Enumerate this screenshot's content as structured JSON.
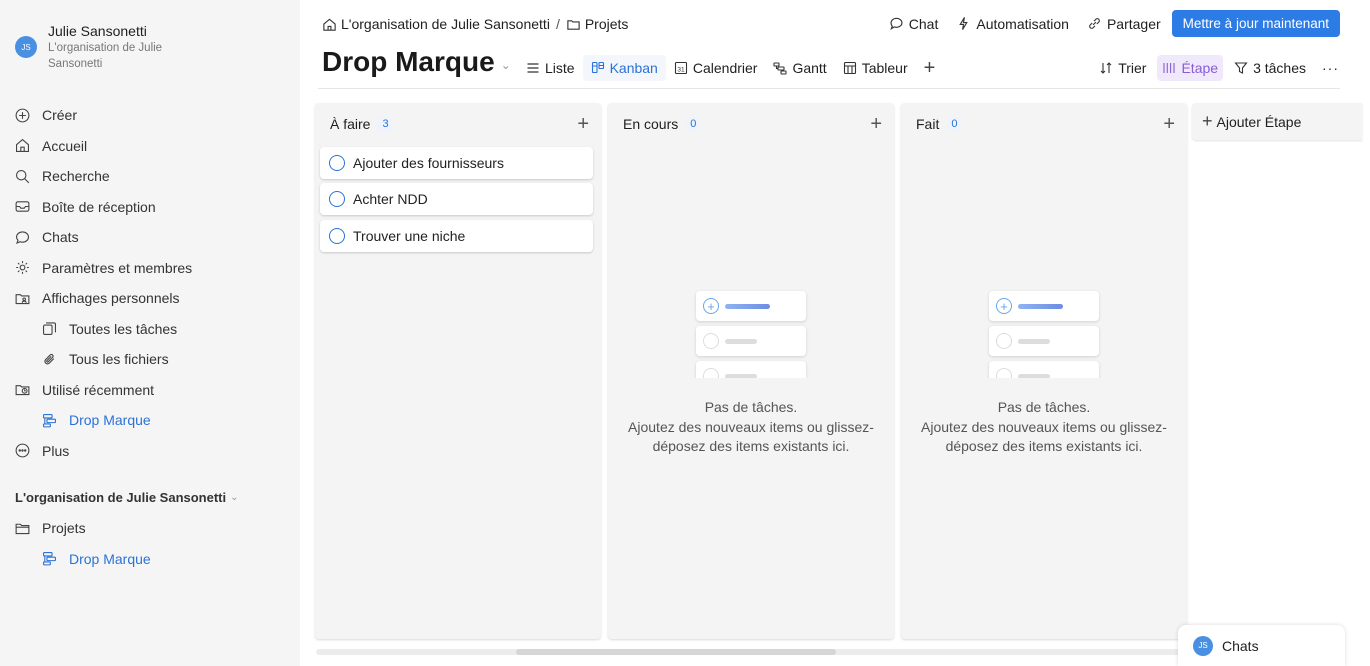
{
  "user": {
    "name": "Julie Sansonetti",
    "org": "L'organisation de Julie Sansonetti",
    "initials": "JS"
  },
  "sidebar": {
    "items": [
      {
        "label": "Créer",
        "icon": "plus-circle-icon"
      },
      {
        "label": "Accueil",
        "icon": "home-icon"
      },
      {
        "label": "Recherche",
        "icon": "search-icon"
      },
      {
        "label": "Boîte de réception",
        "icon": "inbox-icon"
      },
      {
        "label": "Chats",
        "icon": "chat-icon"
      },
      {
        "label": "Paramètres et membres",
        "icon": "gear-icon"
      },
      {
        "label": "Affichages personnels",
        "icon": "folder-person-icon"
      },
      {
        "label": "Toutes les tâches",
        "icon": "tasks-stack-icon"
      },
      {
        "label": "Tous les fichiers",
        "icon": "paperclip-icon"
      },
      {
        "label": "Utilisé récemment",
        "icon": "folder-clock-icon"
      },
      {
        "label": "Drop Marque",
        "icon": "project-icon"
      },
      {
        "label": "Plus",
        "icon": "more-circle-icon"
      }
    ],
    "org_title": "L'organisation de Julie Sansonetti",
    "org_items": [
      {
        "label": "Projets",
        "icon": "folder-icon"
      },
      {
        "label": "Drop Marque",
        "icon": "project-icon"
      }
    ]
  },
  "breadcrumb": {
    "org": "L'organisation de Julie Sansonetti",
    "sep": "/",
    "folder": "Projets"
  },
  "top_actions": {
    "chat": "Chat",
    "automation": "Automatisation",
    "share": "Partager",
    "upgrade": "Mettre à jour maintenant"
  },
  "page_title": "Drop Marque",
  "views": [
    {
      "label": "Liste",
      "icon": "list-icon"
    },
    {
      "label": "Kanban",
      "icon": "kanban-icon"
    },
    {
      "label": "Calendrier",
      "icon": "calendar-icon"
    },
    {
      "label": "Gantt",
      "icon": "gantt-icon"
    },
    {
      "label": "Tableur",
      "icon": "table-icon"
    }
  ],
  "calendar_day": "31",
  "view_actions": {
    "sort": "Trier",
    "stage": "Étape",
    "filter": "3 tâches",
    "more": "···"
  },
  "columns": [
    {
      "title": "À faire",
      "count": "3",
      "tasks": [
        "Ajouter des fournisseurs",
        "Achter NDD",
        "Trouver une niche"
      ]
    },
    {
      "title": "En cours",
      "count": "0",
      "empty_lines": [
        "Pas de tâches.",
        "Ajoutez des nouveaux items ou glissez-déposez des items existants ici."
      ]
    },
    {
      "title": "Fait",
      "count": "0",
      "empty_lines": [
        "Pas de tâches.",
        "Ajoutez des nouveaux items ou glissez-déposez des items existants ici."
      ]
    }
  ],
  "add_stage": "Ajouter Étape",
  "chats_widget": {
    "label": "Chats",
    "initials": "JS"
  },
  "colors": {
    "accent": "#2d7be5",
    "stage_active": "#8b5cd6",
    "sidebar_bg": "#f5f5f5"
  }
}
